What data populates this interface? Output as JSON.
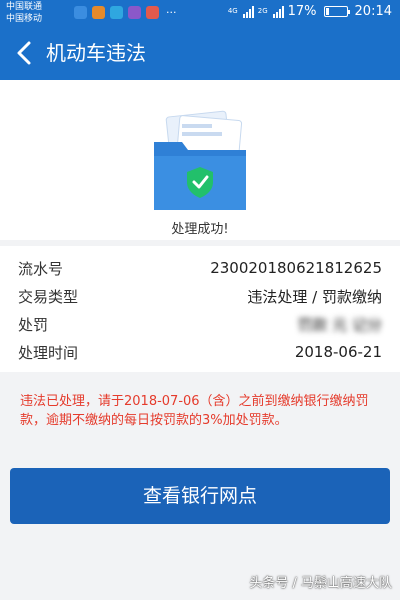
{
  "status_bar": {
    "carrier_1": "中国联通",
    "carrier_2": "中国移动",
    "more": "···",
    "net_1": "4G",
    "net_2": "2G",
    "battery": "17%",
    "time": "20:14",
    "battery_level": 0.17,
    "app_colors": [
      "#3b8de0",
      "#e58a2c",
      "#2fa7e0",
      "#8b58c9",
      "#e25a4d"
    ]
  },
  "header": {
    "title": "机动车违法"
  },
  "result": {
    "message": "处理成功!"
  },
  "details": [
    {
      "label": "流水号",
      "value": "230020180621812625"
    },
    {
      "label": "交易类型",
      "value": "违法处理 / 罚款缴纳"
    },
    {
      "label": "处罚",
      "value": "罚款 元 记分"
    },
    {
      "label": "处理时间",
      "value": "2018-06-21"
    }
  ],
  "notice": "违法已处理，请于2018-07-06（含）之前到缴纳银行缴纳罚款，逾期不缴纳的每日按罚款的3%加处罚款。",
  "button": {
    "label": "查看银行网点"
  },
  "watermark": "头条号 / 马鬃山高速大队",
  "colors": {
    "primary": "#1b70c9",
    "button": "#1b63b8",
    "warning": "#e53b2c",
    "success": "#22c06b"
  }
}
